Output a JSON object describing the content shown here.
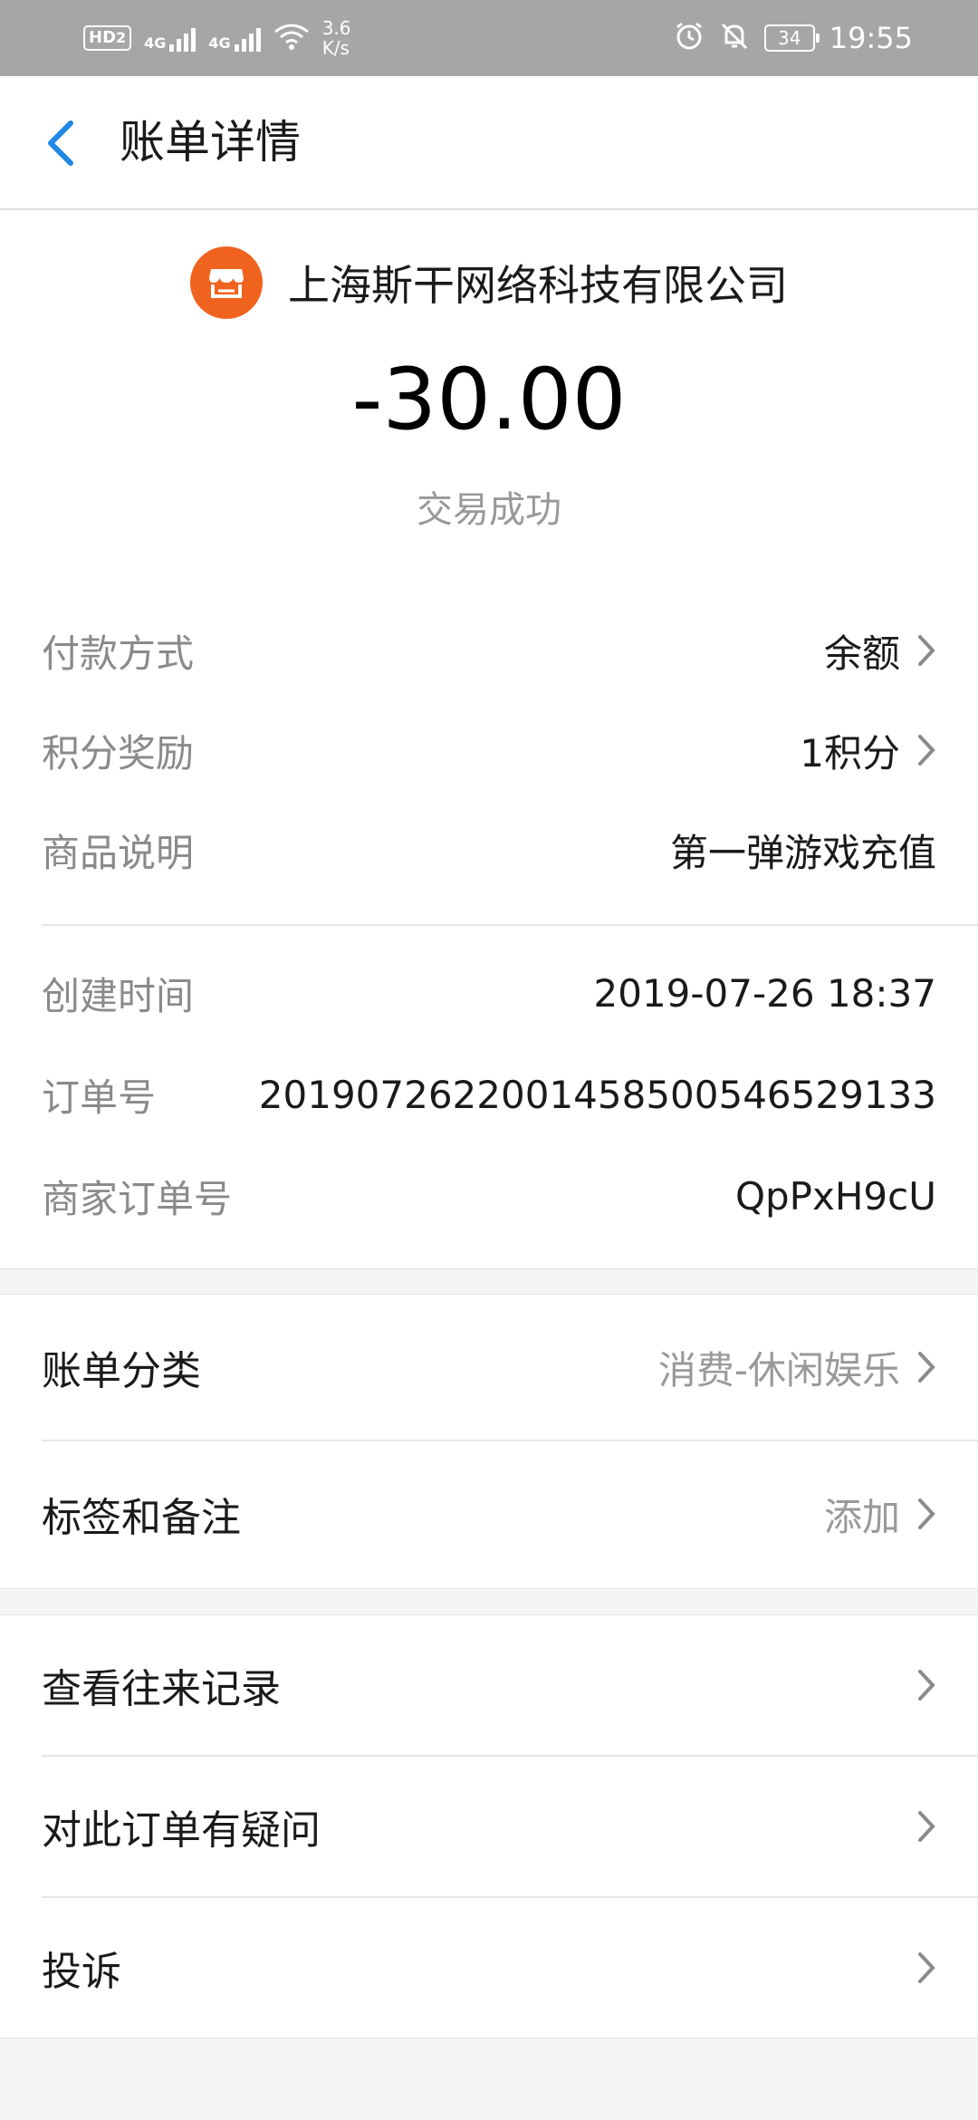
{
  "status_bar": {
    "hd": "HD",
    "hd_sub": "2",
    "sim1": "4G",
    "sim2": "4G",
    "speed_value": "3.6",
    "speed_unit": "K/s",
    "battery": "34",
    "time": "19:55"
  },
  "header": {
    "title": "账单详情"
  },
  "summary": {
    "merchant_name": "上海斯干网络科技有限公司",
    "amount": "-30.00",
    "status": "交易成功"
  },
  "details": [
    {
      "label": "付款方式",
      "value": "余额"
    },
    {
      "label": "积分奖励",
      "value": "1积分"
    },
    {
      "label": "商品说明",
      "value": "第一弹游戏充值"
    },
    {
      "label": "创建时间",
      "value": "2019-07-26 18:37"
    },
    {
      "label": "订单号",
      "value": "2019072622001458500546529133"
    },
    {
      "label": "商家订单号",
      "value": "QpPxH9cU"
    }
  ],
  "group2": [
    {
      "label": "账单分类",
      "value": "消费-休闲娱乐"
    },
    {
      "label": "标签和备注",
      "value": "添加"
    }
  ],
  "group3": [
    {
      "label": "查看往来记录"
    },
    {
      "label": "对此订单有疑问"
    },
    {
      "label": "投诉"
    }
  ],
  "colors": {
    "accent": "#1e88e5",
    "merchant_logo": "#f0631f"
  },
  "icons": [
    "back-arrow-icon",
    "store-icon",
    "chevron-right-icon",
    "alarm-icon",
    "bell-off-icon",
    "wifi-icon",
    "signal-icon",
    "battery-icon"
  ]
}
